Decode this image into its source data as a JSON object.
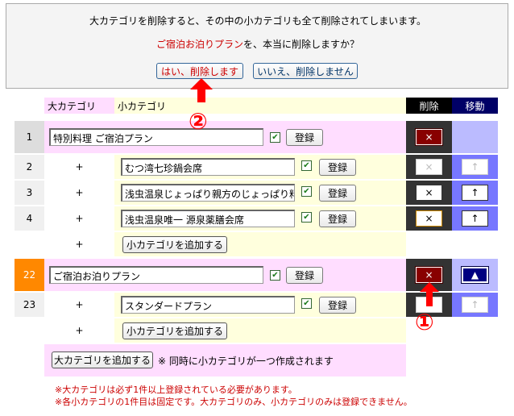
{
  "confirm": {
    "message": "大カテゴリを削除すると、その中の小カテゴリも全て削除されてしまいます。",
    "question_name": "ご宿泊お泊りプラン",
    "question_rest": "を、本当に削除しますか？",
    "yes_label": "はい、削除します",
    "no_label": "いいえ、削除しません"
  },
  "headers": {
    "major": "大カテゴリ",
    "minor": "小カテゴリ",
    "delete": "削除",
    "move": "移動"
  },
  "rows": {
    "r1": {
      "num": "1",
      "name": "特別料理 ご宿泊プラン",
      "checked": "✔",
      "register": "登録",
      "del": "×"
    },
    "r2": {
      "num": "2",
      "plus": "+",
      "name": "むつ湾七珍鍋会席",
      "checked": "✔",
      "register": "登録",
      "del": "×",
      "move": "↑"
    },
    "r3": {
      "num": "3",
      "plus": "+",
      "name": "浅虫温泉じょっぱり親方のじょっぱり料理",
      "checked": "✔",
      "register": "登録",
      "del": "×",
      "move": "↑"
    },
    "r4": {
      "num": "4",
      "plus": "+",
      "name": "浅虫温泉唯一 源泉薬膳会席",
      "checked": "✔",
      "register": "登録",
      "del": "×",
      "move": "↑"
    },
    "add1": {
      "plus": "+",
      "label": "小カテゴリを追加する"
    },
    "r22": {
      "num": "22",
      "name": "ご宿泊お泊りプラン",
      "checked": "✔",
      "register": "登録",
      "del": "×",
      "move": "▲"
    },
    "r23": {
      "num": "23",
      "plus": "+",
      "name": "スタンダードプラン",
      "checked": "✔",
      "register": "登録",
      "move": "↑"
    },
    "add2": {
      "plus": "+",
      "label": "小カテゴリを追加する"
    }
  },
  "footer": {
    "add_major_label": "大カテゴリを追加する",
    "note": "※ 同時に小カテゴリが一つ作成されます",
    "warn1": "※大カテゴリは必ず1件以上登録されている必要があります。",
    "warn2": "※各小カテゴリの1件目は固定です。大カテゴリのみ、小カテゴリのみは登録できません。"
  },
  "annotations": {
    "marker1": "①",
    "marker2": "②"
  },
  "colors": {
    "accent_red": "#cc0000",
    "major_row_bg": "#ffddff",
    "minor_row_bg": "#ffffdd",
    "move_col_bg": "#7777ff",
    "delete_col_bg": "#333333",
    "highlight_num_bg": "#ff8800"
  }
}
